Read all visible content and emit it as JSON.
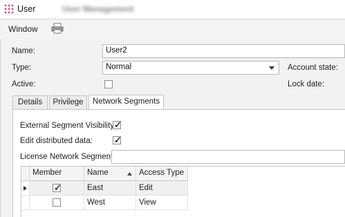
{
  "window": {
    "title": "User",
    "subtitle": "User Management"
  },
  "menubar": {
    "window_label": "Window",
    "print_icon": "printer-icon"
  },
  "form": {
    "name_label": "Name:",
    "name_value": "User2",
    "type_label": "Type:",
    "type_value": "Normal",
    "active_label": "Active:",
    "active_checked": false,
    "account_state_label": "Account state:",
    "lock_date_label": "Lock date:"
  },
  "tabs": [
    {
      "label": "Details",
      "active": false
    },
    {
      "label": "Privilege",
      "active": false
    },
    {
      "label": "Network Segments",
      "active": true
    }
  ],
  "segments": {
    "external_visibility_label": "External Segment Visibility:",
    "external_visibility_checked": true,
    "edit_distributed_label": "Edit distributed data:",
    "edit_distributed_checked": true,
    "license_segment_label": "License Network Segment:",
    "license_segment_value": ""
  },
  "grid": {
    "columns": [
      "Member",
      "Name",
      "Access Type"
    ],
    "sort_column": "Name",
    "sort_direction": "ascending",
    "rows": [
      {
        "member": true,
        "name": "East",
        "access": "Edit",
        "current": true
      },
      {
        "member": false,
        "name": "West",
        "access": "View",
        "current": false
      }
    ]
  },
  "colors": {
    "app_icon": "#e0468a",
    "panel_bg": "#f2f2f2",
    "border": "#c4c4c4"
  }
}
